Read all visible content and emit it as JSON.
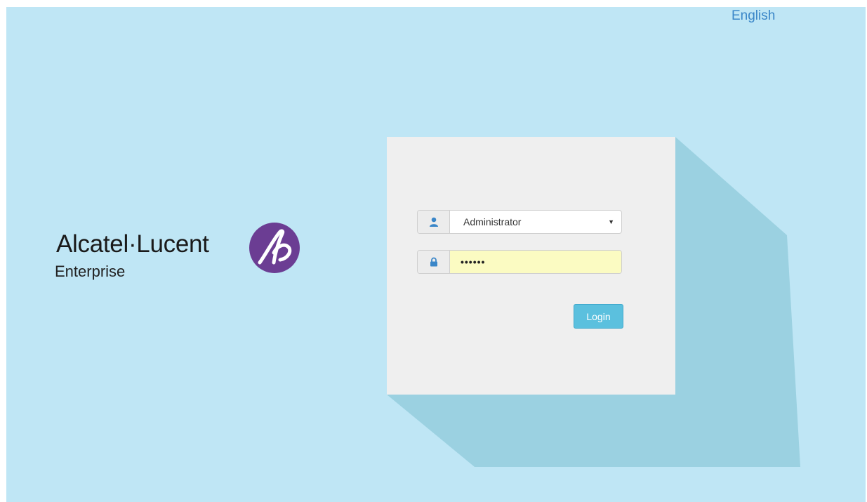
{
  "header": {
    "language_link": "English"
  },
  "brand": {
    "name": "Alcatel·Lucent",
    "sub": "Enterprise",
    "mark_icon": "alcatel-lucent-logo-icon",
    "mark_color": "#6b3d93"
  },
  "login": {
    "user_icon": "user-icon",
    "role_select": {
      "selected": "Administrator"
    },
    "password_icon": "lock-icon",
    "password_value": "••••••",
    "login_label": "Login"
  },
  "colors": {
    "background": "#bfe6f5",
    "shadow": "#9bd1e1",
    "panel": "#efefef",
    "button": "#5bc0de",
    "link": "#3a86c8",
    "autofill": "#fbfbc2"
  }
}
